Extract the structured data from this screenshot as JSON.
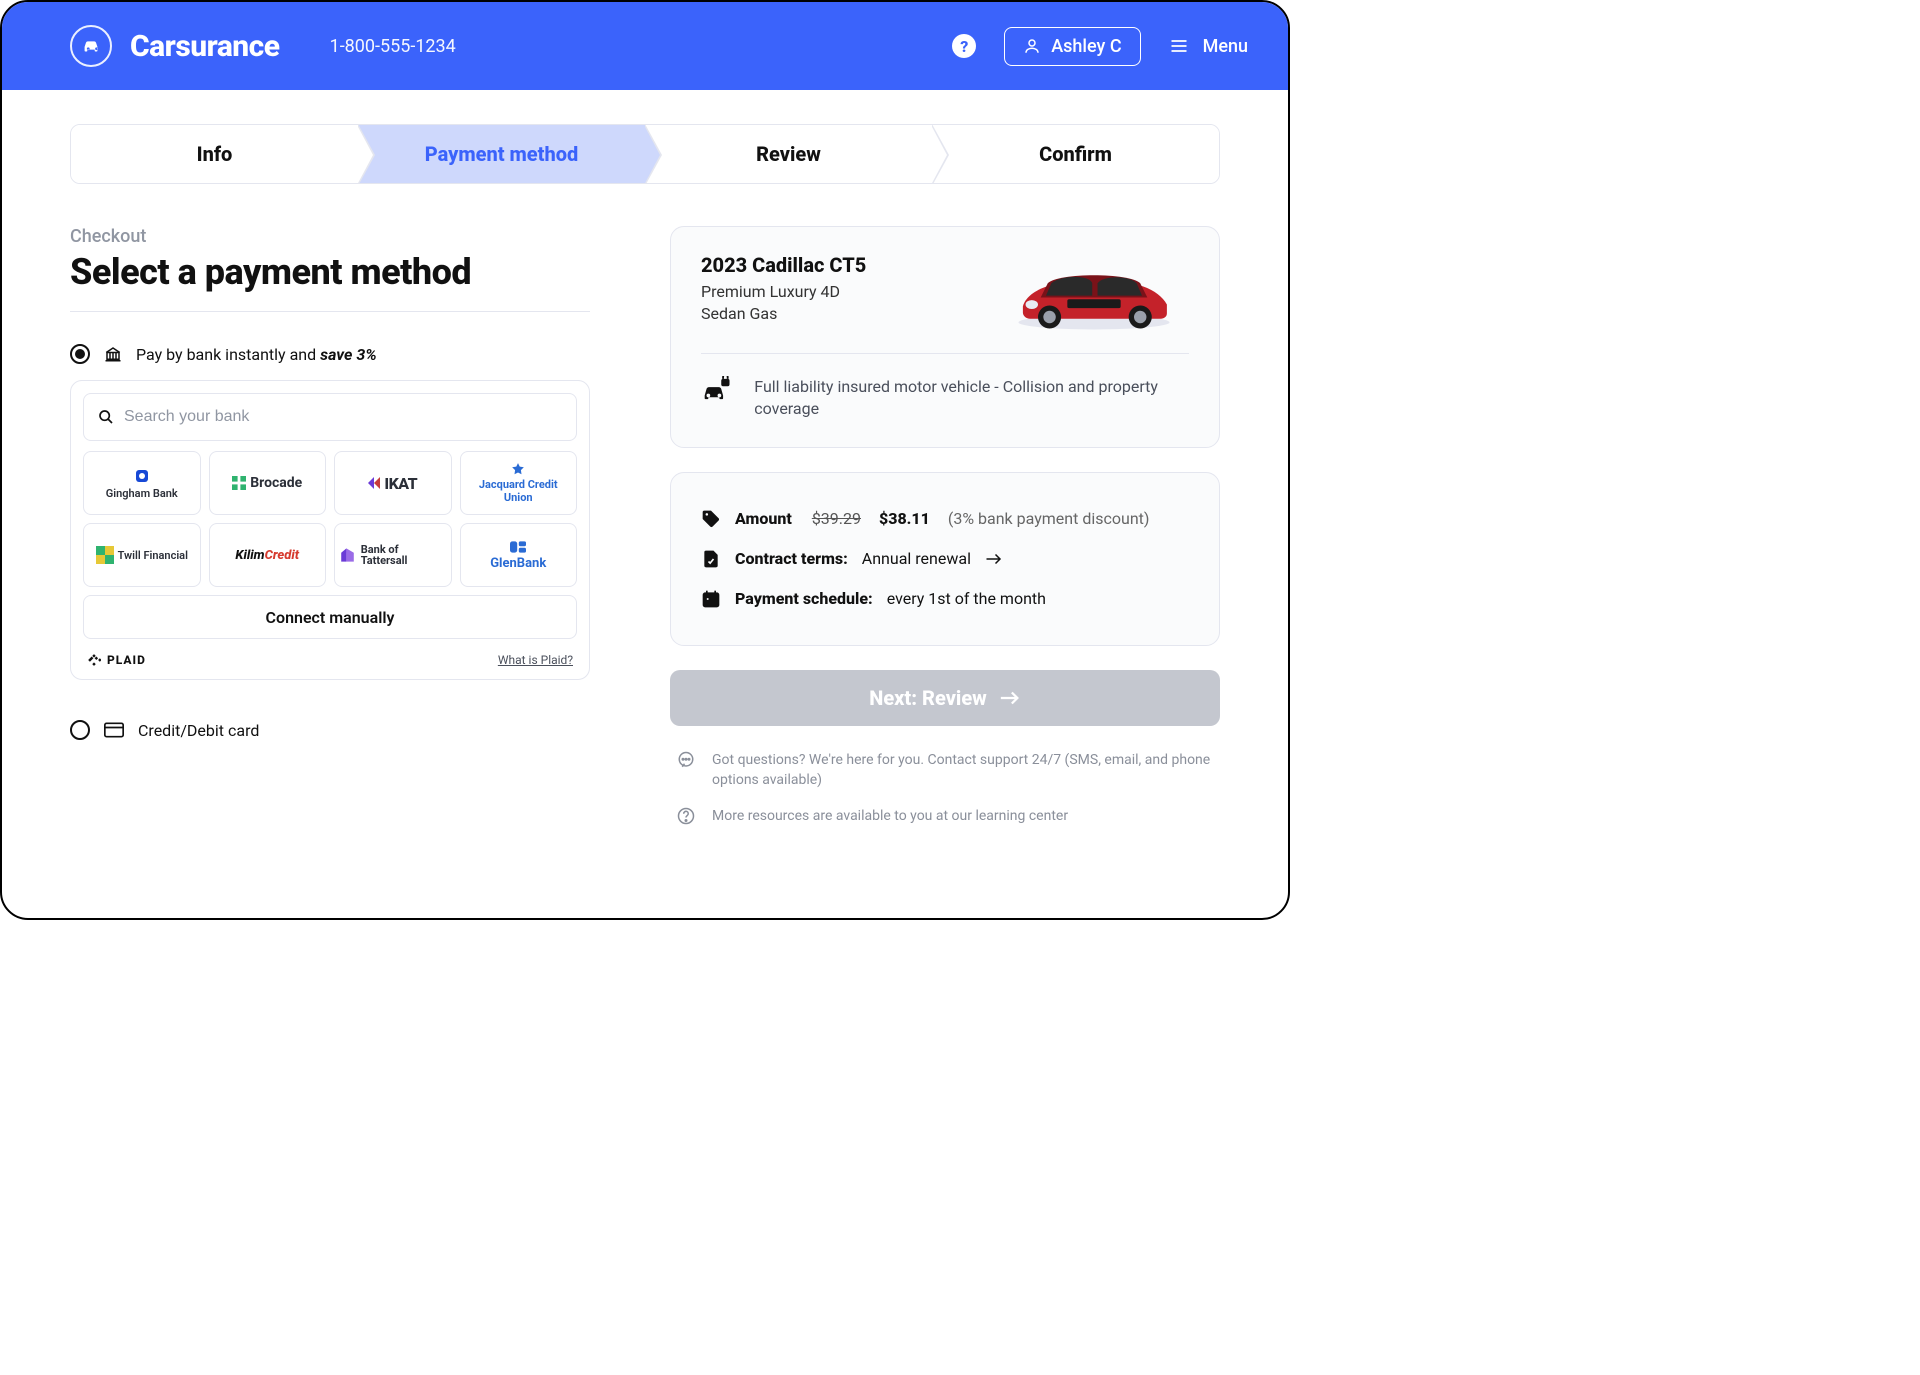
{
  "header": {
    "brand": "Carsurance",
    "phone": "1-800-555-1234",
    "user_name": "Ashley C",
    "menu_label": "Menu"
  },
  "stepper": {
    "steps": [
      "Info",
      "Payment method",
      "Review",
      "Confirm"
    ],
    "active_index": 1
  },
  "checkout": {
    "eyebrow": "Checkout",
    "title": "Select a payment method",
    "bank_option_prefix": "Pay by bank instantly and ",
    "bank_option_save": "save 3%",
    "search_placeholder": "Search your bank",
    "banks": [
      "Gingham Bank",
      "Brocade",
      "IKAT",
      "Jacquard Credit Union",
      "Twill Financial",
      "KilimCredit",
      "Bank of Tattersall",
      "GlenBank"
    ],
    "connect_manual": "Connect manually",
    "plaid_brand": "PLAID",
    "plaid_link": "What is Plaid?",
    "cc_option": "Credit/Debit card"
  },
  "vehicle": {
    "title": "2023 Cadillac CT5",
    "line1": "Premium Luxury 4D",
    "line2": "Sedan Gas",
    "coverage": "Full liability insured motor vehicle - Collision and property coverage"
  },
  "summary": {
    "amount_label": "Amount",
    "amount_strike": "$39.29",
    "amount_price": "$38.11",
    "amount_note": "(3% bank payment discount)",
    "terms_label": "Contract terms:",
    "terms_value": "Annual renewal",
    "schedule_label": "Payment schedule:",
    "schedule_value": "every 1st of the month"
  },
  "next_button": "Next: Review",
  "footer": {
    "support": "Got questions? We're here for you. Contact support 24/7 (SMS, email, and phone options available)",
    "resources": "More resources are available to you at our learning center"
  }
}
